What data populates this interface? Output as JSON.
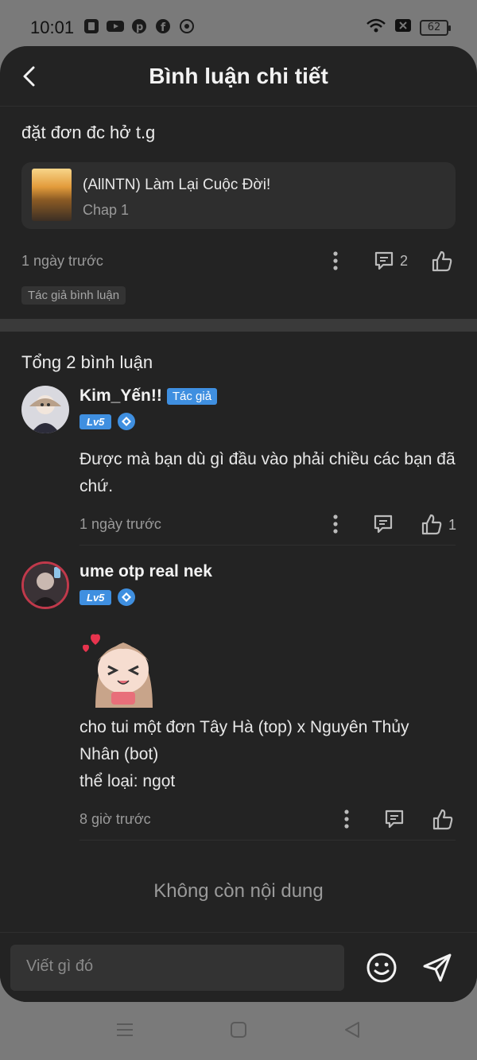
{
  "status_bar": {
    "time": "10:01",
    "battery": "62"
  },
  "header": {
    "title": "Bình luận chi tiết"
  },
  "post": {
    "text": "đặt đơn đc hở t.g",
    "work_title": "(AllNTN) Làm Lại Cuộc Đời!",
    "chapter": "Chap 1",
    "time": "1 ngày trước",
    "reply_count": "2",
    "tag": "Tác giả bình luận"
  },
  "comments_section": {
    "total": "Tổng 2 bình luận",
    "items": [
      {
        "name": "Kim_Yến!!",
        "badge": "Tác giả",
        "level": "Lv5",
        "text": "Được mà bạn dù gì đầu vào phải chiều các bạn đã chứ.",
        "time": "1 ngày trước",
        "likes": "1"
      },
      {
        "name": "ume otp real nek",
        "level": "Lv5",
        "text_lines": [
          "cho tui một đơn Tây Hà (top) x Nguyên Thủy",
          "Nhân (bot)",
          "thể loại: ngọt"
        ],
        "time": "8 giờ trước"
      }
    ]
  },
  "end_text": "Không còn nội dung",
  "input": {
    "placeholder": "Viết gì đó"
  },
  "colors": {
    "accent": "#3f8fe0",
    "background": "#232323"
  }
}
